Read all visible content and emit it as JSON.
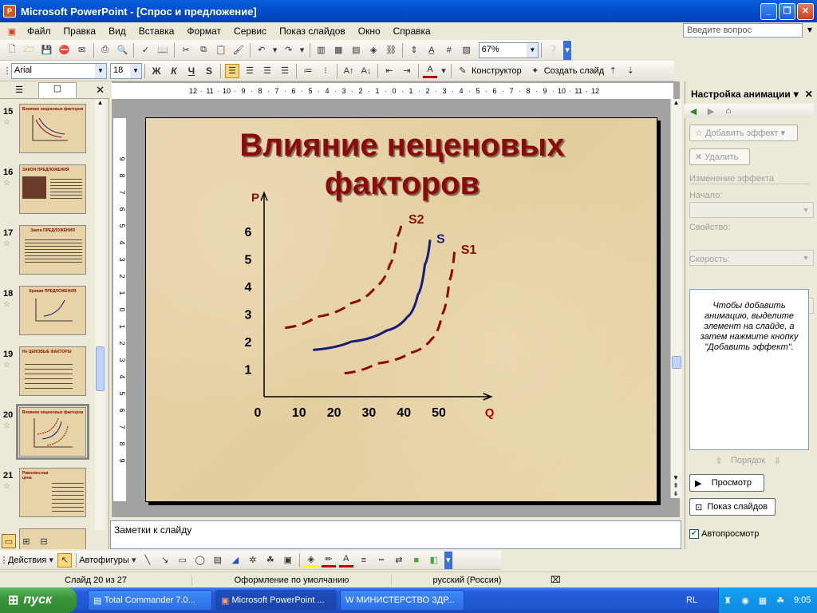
{
  "window": {
    "title": "Microsoft PowerPoint - [Спрос и предложение]"
  },
  "menu": {
    "items": [
      "Файл",
      "Правка",
      "Вид",
      "Вставка",
      "Формат",
      "Сервис",
      "Показ слайдов",
      "Окно",
      "Справка"
    ],
    "help_placeholder": "Введите вопрос"
  },
  "toolbar": {
    "zoom": "67%",
    "font": "Arial",
    "font_size": "18",
    "bold": "Ж",
    "italic": "К",
    "underline": "Ч",
    "shadow": "S",
    "designer": "Конструктор",
    "new_slide": "Создать слайд"
  },
  "slides_pane": {
    "thumbs": [
      {
        "num": "15",
        "title": "Влияние неценовых факторов"
      },
      {
        "num": "16",
        "title": "ЗАКОН ПРЕДЛОЖЕНИЯ"
      },
      {
        "num": "17",
        "title": "Закон ПРЕДЛОЖЕНИЯ"
      },
      {
        "num": "18",
        "title": "Кривая ПРЕДЛОЖЕНИЯ"
      },
      {
        "num": "19",
        "title": "Не ЦЕНОВЫЕ ФАКТОРЫ"
      },
      {
        "num": "20",
        "title": "Влияние неценовых факторов"
      },
      {
        "num": "21",
        "title": "Равновесная цена"
      }
    ],
    "selected": "20"
  },
  "slide": {
    "title_line1": "Влияние неценовых",
    "title_line2": "факторов"
  },
  "chart_data": {
    "type": "line",
    "title": "",
    "xlabel": "Q",
    "ylabel": "P",
    "x_ticks": [
      "0",
      "10",
      "20",
      "30",
      "40",
      "50"
    ],
    "y_ticks": [
      "1",
      "2",
      "3",
      "4",
      "5",
      "6"
    ],
    "xlim": [
      0,
      65
    ],
    "ylim": [
      0,
      7
    ],
    "series": [
      {
        "name": "S2",
        "style": "dashed",
        "color": "#8B0A0A",
        "x": [
          6,
          15,
          25,
          32,
          36,
          38,
          39.5
        ],
        "y": [
          2.5,
          2.9,
          3.4,
          4.0,
          4.8,
          5.8,
          6.4
        ]
      },
      {
        "name": "S",
        "style": "solid",
        "color": "#1A1A7A",
        "x": [
          14,
          25,
          35,
          41,
          44,
          46,
          47.5
        ],
        "y": [
          1.7,
          2.0,
          2.4,
          2.9,
          3.7,
          4.8,
          5.7
        ]
      },
      {
        "name": "S1",
        "style": "dashed",
        "color": "#8B0A0A",
        "x": [
          23,
          32,
          42,
          48,
          51,
          53,
          54.5
        ],
        "y": [
          0.85,
          1.2,
          1.6,
          2.1,
          3.0,
          4.2,
          5.3
        ]
      }
    ]
  },
  "notes": {
    "placeholder": "Заметки к слайду"
  },
  "taskpane": {
    "title": "Настройка анимации",
    "add_effect": "Добавить эффект",
    "remove": "Удалить",
    "change_effect": "Изменение эффекта",
    "start_label": "Начало:",
    "property_label": "Свойство:",
    "speed_label": "Скорость:",
    "info": "Чтобы добавить анимацию, выделите элемент на слайде, а затем нажмите кнопку \"Добавить эффект\".",
    "order": "Порядок",
    "preview": "Просмотр",
    "slideshow": "Показ слайдов",
    "autopreview": "Автопросмотр"
  },
  "drawing": {
    "actions": "Действия",
    "autoshapes": "Автофигуры"
  },
  "status": {
    "slide": "Слайд 20 из 27",
    "design": "Оформление по умолчанию",
    "lang": "русский (Россия)"
  },
  "taskbar": {
    "start": "пуск",
    "items": [
      "Total Commander 7.0...",
      "Microsoft PowerPoint ...",
      "МИНИСТЕРСТВО ЗДР..."
    ],
    "lang": "RL",
    "time": "9:05"
  }
}
